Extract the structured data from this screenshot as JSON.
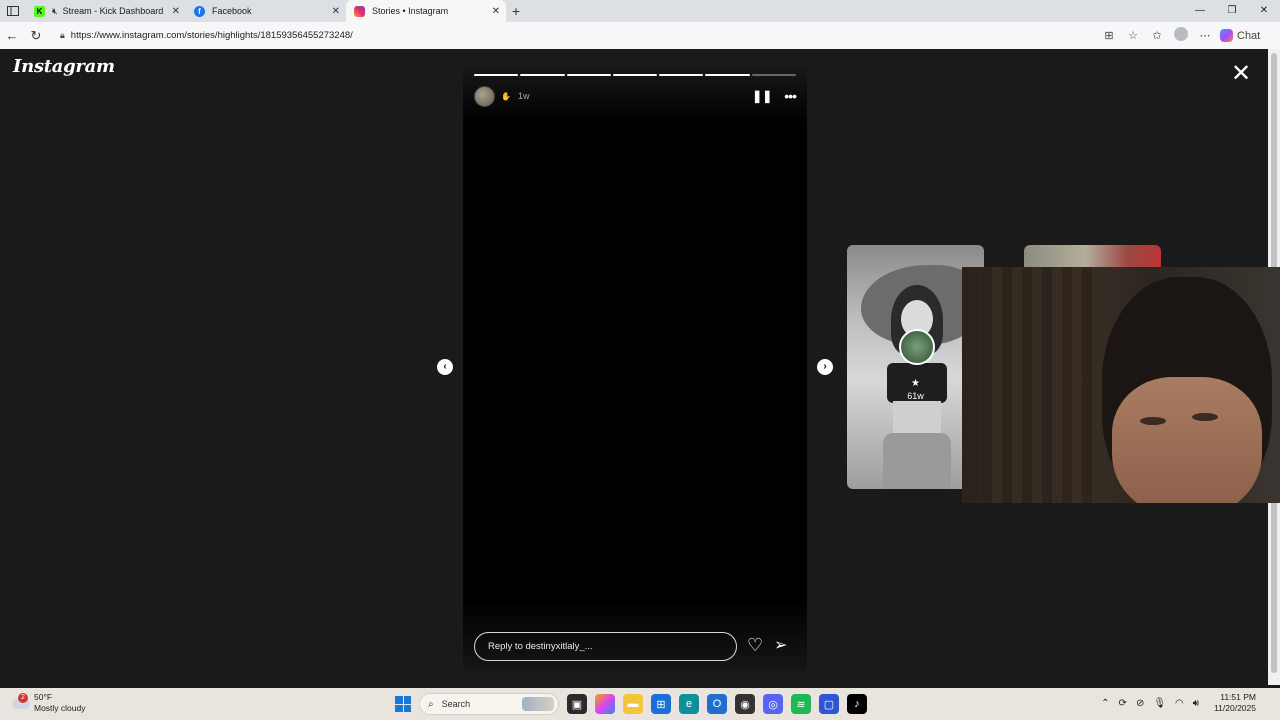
{
  "browser": {
    "tabs": [
      {
        "label": "Stream - Kick Dashboard",
        "muted": true
      },
      {
        "label": "Facebook"
      },
      {
        "label": "Stories • Instagram",
        "active": true
      }
    ],
    "url": "https://www.instagram.com/stories/highlights/18159356455273248/",
    "chat_label": "Chat"
  },
  "instagram": {
    "logo": "Instagram",
    "story": {
      "time_ago": "1w",
      "segments_total": 7,
      "segments_done": 6,
      "reply_placeholder": "Reply to destinyxitlaly_..."
    },
    "next_preview": {
      "time_ago": "61w"
    }
  },
  "taskbar": {
    "weather": {
      "temp": "50°F",
      "condition": "Mostly cloudy",
      "badge": "2"
    },
    "search_label": "Search",
    "time": "11:51 PM",
    "date": "11/20/2025"
  },
  "colors": {
    "accent": "#1a78d4",
    "story_bg": "#000000",
    "page_bg": "#1a1a1a"
  }
}
